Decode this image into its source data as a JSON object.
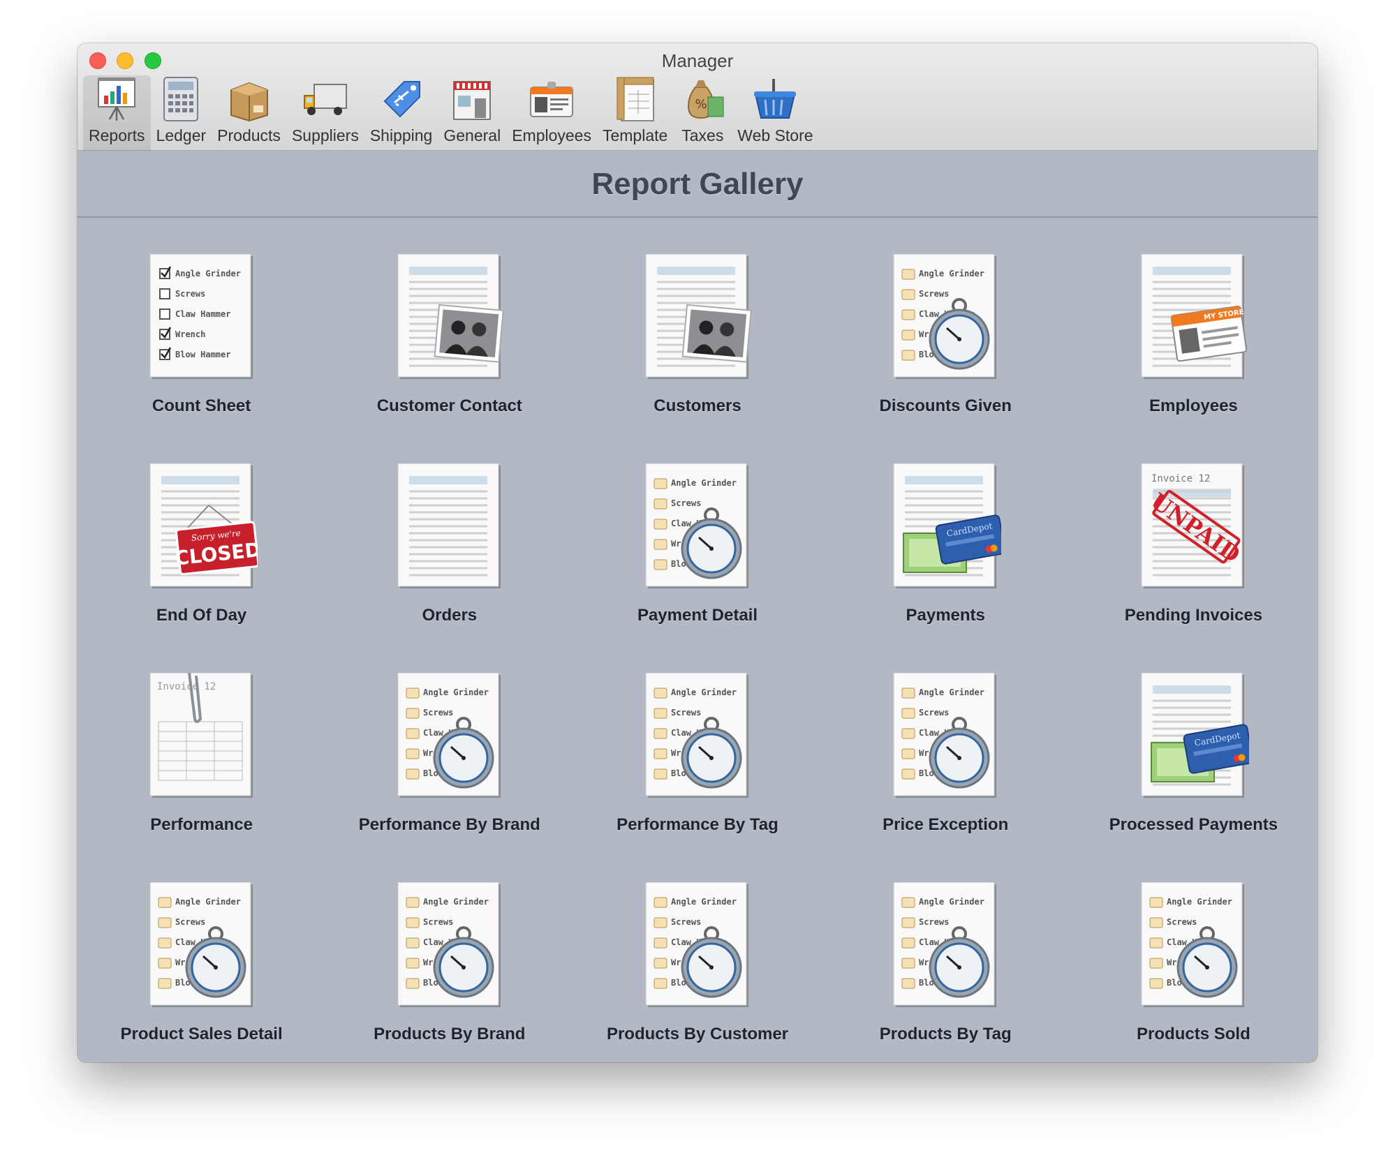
{
  "window": {
    "title": "Manager"
  },
  "toolbar": {
    "items": [
      {
        "label": "Reports",
        "icon": "reports-chart-icon",
        "active": true
      },
      {
        "label": "Ledger",
        "icon": "ledger-calculator-icon"
      },
      {
        "label": "Products",
        "icon": "products-box-icon"
      },
      {
        "label": "Suppliers",
        "icon": "suppliers-truck-icon"
      },
      {
        "label": "Shipping",
        "icon": "shipping-tag-icon"
      },
      {
        "label": "General",
        "icon": "general-storefront-icon"
      },
      {
        "label": "Employees",
        "icon": "employees-id-card-icon"
      },
      {
        "label": "Template",
        "icon": "template-ruler-icon"
      },
      {
        "label": "Taxes",
        "icon": "taxes-money-bag-icon"
      },
      {
        "label": "Web Store",
        "icon": "web-store-basket-icon"
      }
    ]
  },
  "gallery": {
    "title": "Report Gallery",
    "reports": [
      {
        "label": "Count Sheet",
        "thumb": "checklist"
      },
      {
        "label": "Customer Contact",
        "thumb": "photo"
      },
      {
        "label": "Customers",
        "thumb": "photo"
      },
      {
        "label": "Discounts Given",
        "thumb": "stopwatch"
      },
      {
        "label": "Employees",
        "thumb": "idcard"
      },
      {
        "label": "End Of Day",
        "thumb": "closed"
      },
      {
        "label": "Orders",
        "thumb": "table"
      },
      {
        "label": "Payment Detail",
        "thumb": "stopwatch"
      },
      {
        "label": "Payments",
        "thumb": "creditcard"
      },
      {
        "label": "Pending Invoices",
        "thumb": "unpaid"
      },
      {
        "label": "Performance",
        "thumb": "invoice"
      },
      {
        "label": "Performance By Brand",
        "thumb": "stopwatch"
      },
      {
        "label": "Performance By Tag",
        "thumb": "stopwatch"
      },
      {
        "label": "Price Exception",
        "thumb": "stopwatch"
      },
      {
        "label": "Processed Payments",
        "thumb": "creditcard"
      },
      {
        "label": "Product Sales Detail",
        "thumb": "stopwatch"
      },
      {
        "label": "Products By Brand",
        "thumb": "stopwatch"
      },
      {
        "label": "Products By Customer",
        "thumb": "stopwatch"
      },
      {
        "label": "Products By Tag",
        "thumb": "stopwatch"
      },
      {
        "label": "Products Sold",
        "thumb": "stopwatch"
      }
    ],
    "thumb_text": {
      "list_items": [
        "Angle Grinder",
        "Screws",
        "Claw Hammer",
        "Wrench",
        "Blow Hammer"
      ],
      "closed_sign_top": "Sorry we're",
      "closed_sign_main": "CLOSED",
      "unpaid_stamp": "UNPAID",
      "invoice_title": "Invoice 12",
      "card_brand": "CardDepot",
      "store_badge": "MY STORE"
    }
  }
}
